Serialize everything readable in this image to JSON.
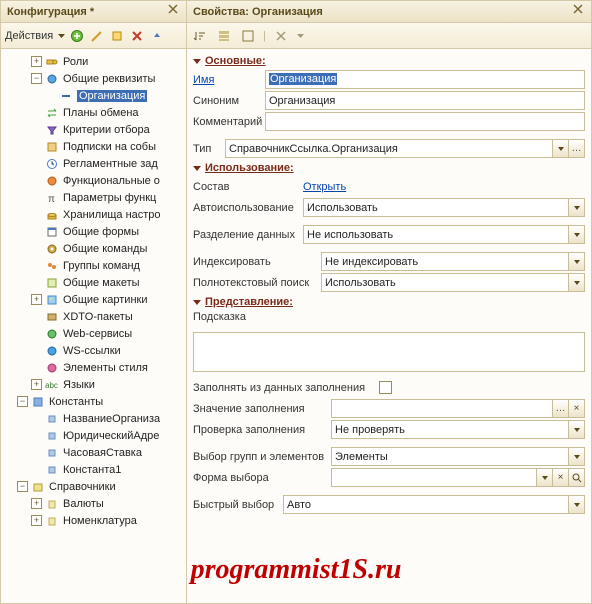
{
  "left": {
    "title": "Конфигурация *",
    "actions_label": "Действия",
    "tree": {
      "roles": "Роли",
      "common_attrs": "Общие реквизиты",
      "organization": "Организация",
      "exchange_plans": "Планы обмена",
      "selection_criteria": "Критерии отбора",
      "event_subscriptions": "Подписки на собы",
      "scheduled_jobs": "Регламентные зад",
      "functional_options": "Функциональные о",
      "function_params": "Параметры функц",
      "settings_storages": "Хранилища настро",
      "common_forms": "Общие формы",
      "common_commands": "Общие команды",
      "command_groups": "Группы команд",
      "common_templates": "Общие макеты",
      "common_pictures": "Общие картинки",
      "xdto": "XDTO-пакеты",
      "web_services": "Web-сервисы",
      "ws_refs": "WS-ссылки",
      "style_elements": "Элементы стиля",
      "languages": "Языки",
      "constants": "Константы",
      "c_org_name": "НазваниеОрганиза",
      "c_legal_addr": "ЮридическийАдре",
      "c_hourly_rate": "ЧасоваяСтавка",
      "c_const1": "Константа1",
      "catalogs": "Справочники",
      "cat_currency": "Валюты",
      "cat_nomenclature": "Номенклатура"
    }
  },
  "right": {
    "title": "Свойства: Организация",
    "sections": {
      "main": "Основные:",
      "usage": "Использование:",
      "presentation": "Представление:"
    },
    "labels": {
      "name": "Имя",
      "synonym": "Синоним",
      "comment": "Комментарий",
      "type": "Тип",
      "content": "Состав",
      "open": "Открыть",
      "auto_use": "Автоиспользование",
      "data_sep": "Разделение данных",
      "indexing": "Индексировать",
      "fulltext": "Полнотекстовый поиск",
      "hint": "Подсказка",
      "fill_from": "Заполнять из данных заполнения",
      "fill_value": "Значение заполнения",
      "fill_check": "Проверка заполнения",
      "groups_elems": "Выбор групп и элементов",
      "choose_form": "Форма выбора",
      "quick_choice": "Быстрый выбор"
    },
    "values": {
      "name": "Организация",
      "synonym": "Организация",
      "comment": "",
      "type": "СправочникСсылка.Организация",
      "auto_use": "Использовать",
      "data_sep": "Не использовать",
      "indexing": "Не индексировать",
      "fulltext": "Использовать",
      "hint": "",
      "fill_value": "",
      "fill_check": "Не проверять",
      "groups_elems": "Элементы",
      "choose_form": "",
      "quick_choice": "Авто"
    }
  },
  "watermark": "programmist1S.ru"
}
